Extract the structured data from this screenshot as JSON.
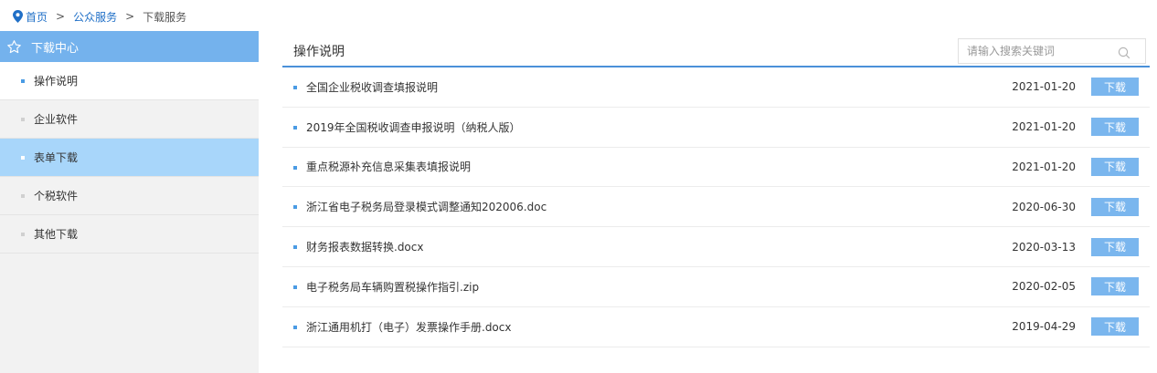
{
  "breadcrumb": {
    "home": "首页",
    "sep1": ">",
    "level2": "公众服务",
    "sep2": ">",
    "current": "下载服务"
  },
  "sidebar": {
    "title": "下载中心",
    "items": [
      {
        "label": "操作说明"
      },
      {
        "label": "企业软件"
      },
      {
        "label": "表单下载"
      },
      {
        "label": "个税软件"
      },
      {
        "label": "其他下载"
      }
    ]
  },
  "main": {
    "title": "操作说明",
    "search_placeholder": "请输入搜索关键词",
    "download_label": "下载",
    "rows": [
      {
        "title": "全国企业税收调查填报说明",
        "date": "2021-01-20"
      },
      {
        "title": "2019年全国税收调查申报说明（纳税人版）",
        "date": "2021-01-20"
      },
      {
        "title": "重点税源补充信息采集表填报说明",
        "date": "2021-01-20"
      },
      {
        "title": "浙江省电子税务局登录模式调整通知202006.doc",
        "date": "2020-06-30"
      },
      {
        "title": "财务报表数据转换.docx",
        "date": "2020-03-13"
      },
      {
        "title": "电子税务局车辆购置税操作指引.zip",
        "date": "2020-02-05"
      },
      {
        "title": "浙江通用机打（电子）发票操作手册.docx",
        "date": "2019-04-29"
      }
    ]
  },
  "colors": {
    "accent": "#4a90d9",
    "sidebar_header": "#74b2ed",
    "sidebar_active": "#a8d6fa",
    "button": "#7ab6ee",
    "link": "#1f6fc7"
  }
}
